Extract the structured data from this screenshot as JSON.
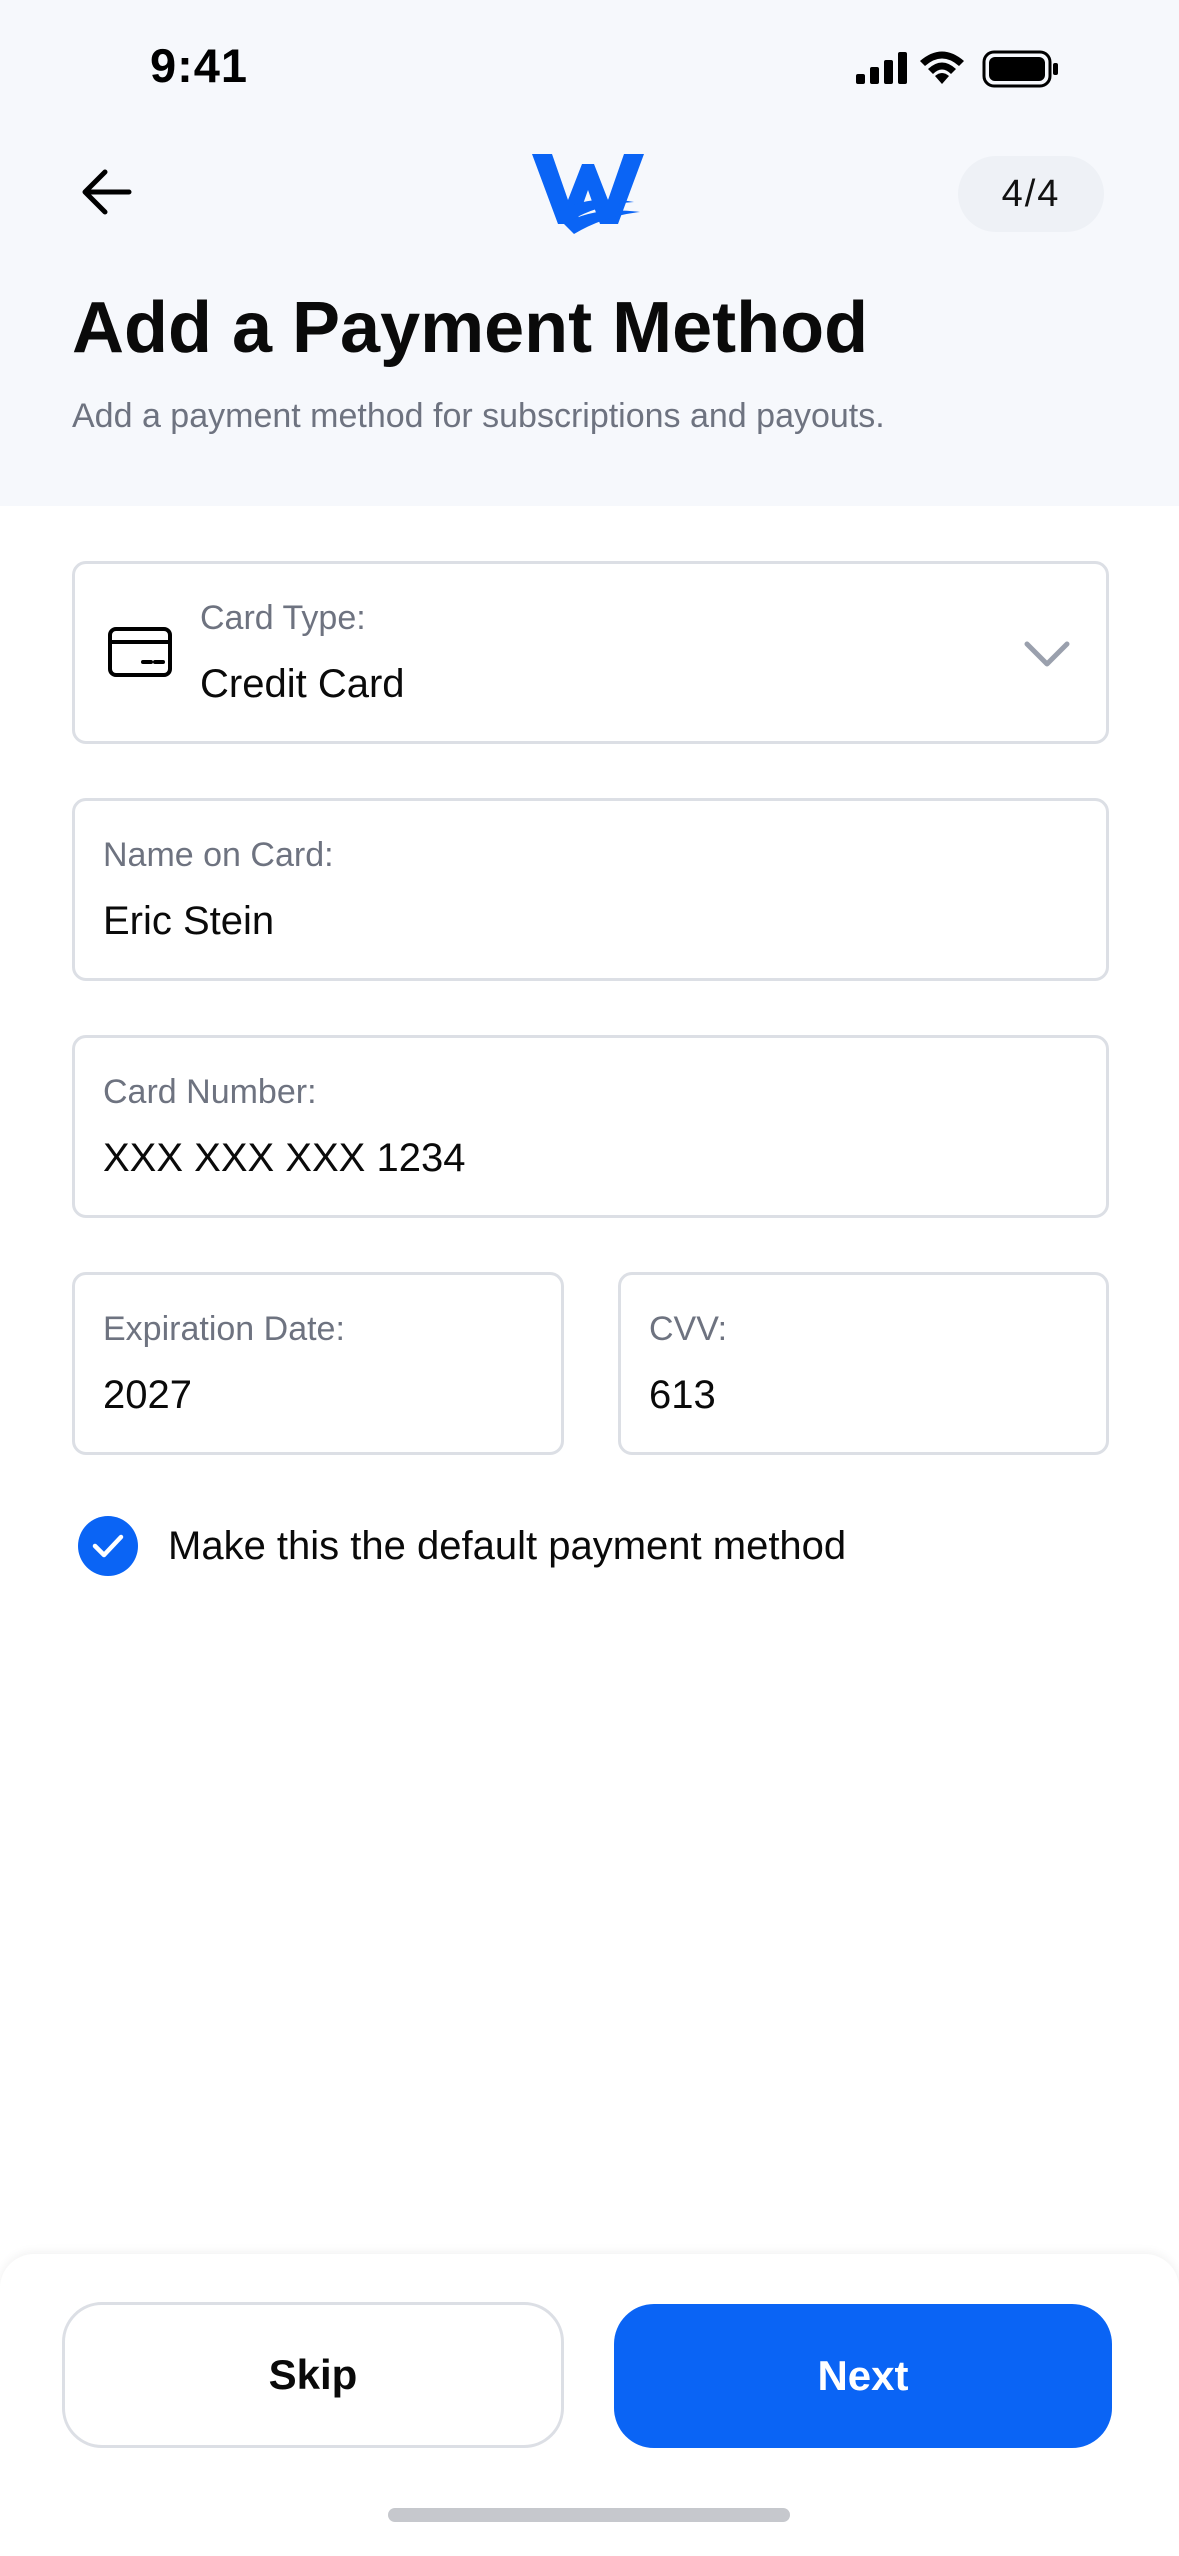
{
  "status_bar": {
    "time": "9:41",
    "icons": [
      "signal-icon",
      "wifi-icon",
      "battery-icon"
    ]
  },
  "header": {
    "back_icon": "arrow-left-icon",
    "logo_icon": "w-wave-logo",
    "step": "4/4",
    "title": "Add a Payment Method",
    "subtitle": "Add a payment method for subscriptions and payouts."
  },
  "form": {
    "card_type": {
      "label": "Card Type:",
      "value": "Credit Card",
      "icon": "credit-card-icon"
    },
    "name": {
      "label": "Name on Card:",
      "value": "Eric Stein"
    },
    "card_number": {
      "label": "Card Number:",
      "value": "XXX XXX XXX 1234"
    },
    "expiration": {
      "label": "Expiration Date:",
      "value": "2027"
    },
    "cvv": {
      "label": "CVV:",
      "value": "613"
    },
    "default_checkbox": {
      "label": "Make this the default payment method",
      "checked": true
    }
  },
  "actions": {
    "skip_label": "Skip",
    "next_label": "Next"
  },
  "colors": {
    "accent": "#0a64f5",
    "header_bg": "#f6f8fc",
    "border": "#dcdfe5",
    "muted_text": "#6e7380"
  }
}
